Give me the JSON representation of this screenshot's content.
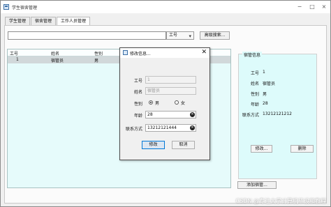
{
  "window": {
    "title": "学生宿舍管理"
  },
  "tabs": [
    {
      "label": "学生管理"
    },
    {
      "label": "宿舍管理"
    },
    {
      "label": "工作人员管理"
    }
  ],
  "search": {
    "select": "工号",
    "button": "高级搜索..."
  },
  "table": {
    "headers": [
      "工号",
      "姓名",
      "性别"
    ],
    "rows": [
      {
        "num": "1",
        "name": "宿管员",
        "gender": "男"
      }
    ]
  },
  "info": {
    "title": "宿管信息",
    "fields": [
      {
        "label": "工号",
        "value": "1"
      },
      {
        "label": "姓名",
        "value": "宿管员"
      },
      {
        "label": "性别",
        "value": "男"
      },
      {
        "label": "年龄",
        "value": "28"
      },
      {
        "label": "联系方式",
        "value": "13212121212"
      }
    ],
    "edit_button": "修改...",
    "delete_button": "删除"
  },
  "add_button": "添加宿管...",
  "dialog": {
    "title": "修改信息...",
    "close_symbol": "✕",
    "fields": {
      "id_label": "工号",
      "id_value": "1",
      "name_label": "姓名",
      "name_value": "宿管员",
      "gender_label": "性别",
      "male": "男",
      "female": "女",
      "age_label": "年龄",
      "age_value": "28",
      "contact_label": "联系方式",
      "contact_value": "13212121444"
    },
    "edit_button": "修改",
    "cancel_button": "取消"
  },
  "watermark": "CSDN @专注大学计算机毕设和教程",
  "icons": {
    "app": "app-icon",
    "minimize": "−",
    "maximize": "□",
    "close": "×",
    "dropdown": "▾",
    "clear": "✕"
  }
}
